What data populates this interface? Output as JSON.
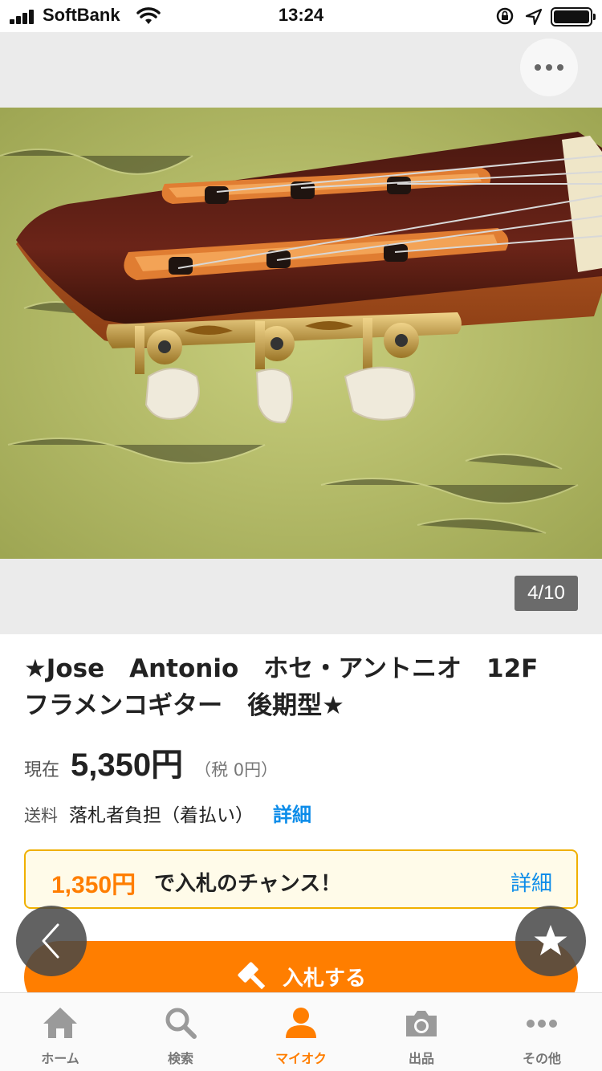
{
  "status_bar": {
    "carrier": "SoftBank",
    "time": "13:24"
  },
  "gallery": {
    "counter": "4/10"
  },
  "item": {
    "title": "★Jose　Antonio　ホセ・アントニオ　12F　フラメンコギター　後期型★",
    "price_label": "現在",
    "price": "5,350円",
    "tax": "（税 0円）",
    "shipping_label": "送料",
    "shipping_value": "落札者負担（着払い）",
    "shipping_detail": "詳細"
  },
  "chance": {
    "amount": "1,350円",
    "text": "で入札のチャンス！",
    "detail": "詳細"
  },
  "bid_button": {
    "label": "入札する"
  },
  "tabs": [
    {
      "label": "ホーム",
      "icon": "home-icon"
    },
    {
      "label": "検索",
      "icon": "search-icon"
    },
    {
      "label": "マイオク",
      "icon": "user-icon"
    },
    {
      "label": "出品",
      "icon": "camera-icon"
    },
    {
      "label": "その他",
      "icon": "more-icon"
    }
  ],
  "colors": {
    "accent": "#ff7e00",
    "link": "#0c8ce9",
    "chance_border": "#f0b000"
  }
}
